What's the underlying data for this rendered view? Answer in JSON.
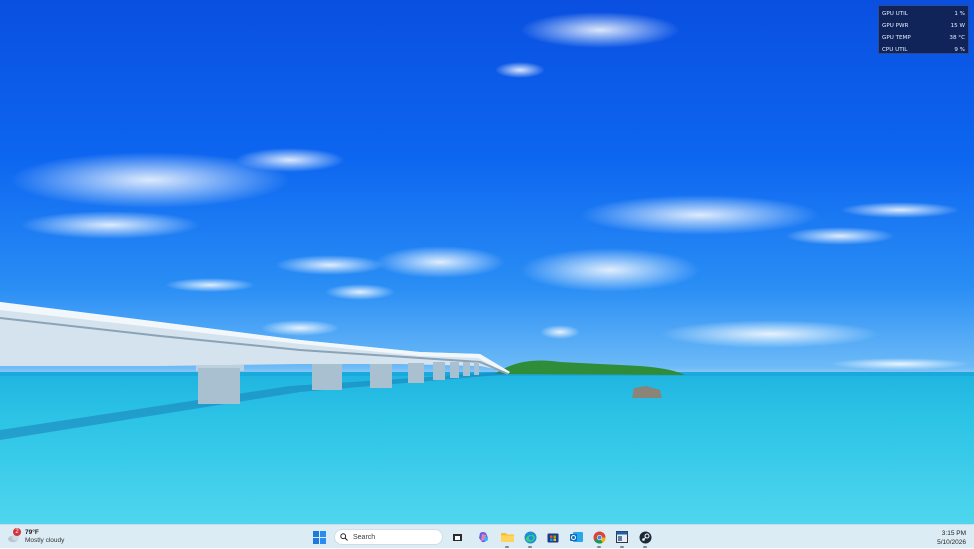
{
  "gpu_widget": {
    "rows": [
      {
        "label": "GPU UTIL",
        "value": "1 %"
      },
      {
        "label": "GPU PWR",
        "value": "15 W"
      },
      {
        "label": "GPU TEMP",
        "value": "38 °C"
      },
      {
        "label": "CPU UTIL",
        "value": "9 %"
      }
    ]
  },
  "taskbar": {
    "weather": {
      "badge": "2",
      "temperature": "79°F",
      "condition": "Mostly cloudy",
      "icon": "weather-cloud-icon"
    },
    "search": {
      "placeholder": "Search"
    },
    "apps": [
      {
        "name": "task-view",
        "icon": "task-view-icon"
      },
      {
        "name": "copilot",
        "icon": "copilot-icon"
      },
      {
        "name": "file-explorer",
        "icon": "folder-icon"
      },
      {
        "name": "edge",
        "icon": "edge-icon"
      },
      {
        "name": "store",
        "icon": "store-icon"
      },
      {
        "name": "outlook",
        "icon": "outlook-icon"
      },
      {
        "name": "chrome",
        "icon": "chrome-icon"
      },
      {
        "name": "app-window",
        "icon": "app-window-icon"
      },
      {
        "name": "steam",
        "icon": "steam-icon"
      }
    ],
    "clock": {
      "time": "3:15 PM",
      "date": "5/10/2026"
    }
  },
  "colors": {
    "sky_top": "#0a4fe0",
    "sea": "#35c8e8",
    "taskbar": "#dcecf4",
    "widget_bg": "#10245a"
  }
}
